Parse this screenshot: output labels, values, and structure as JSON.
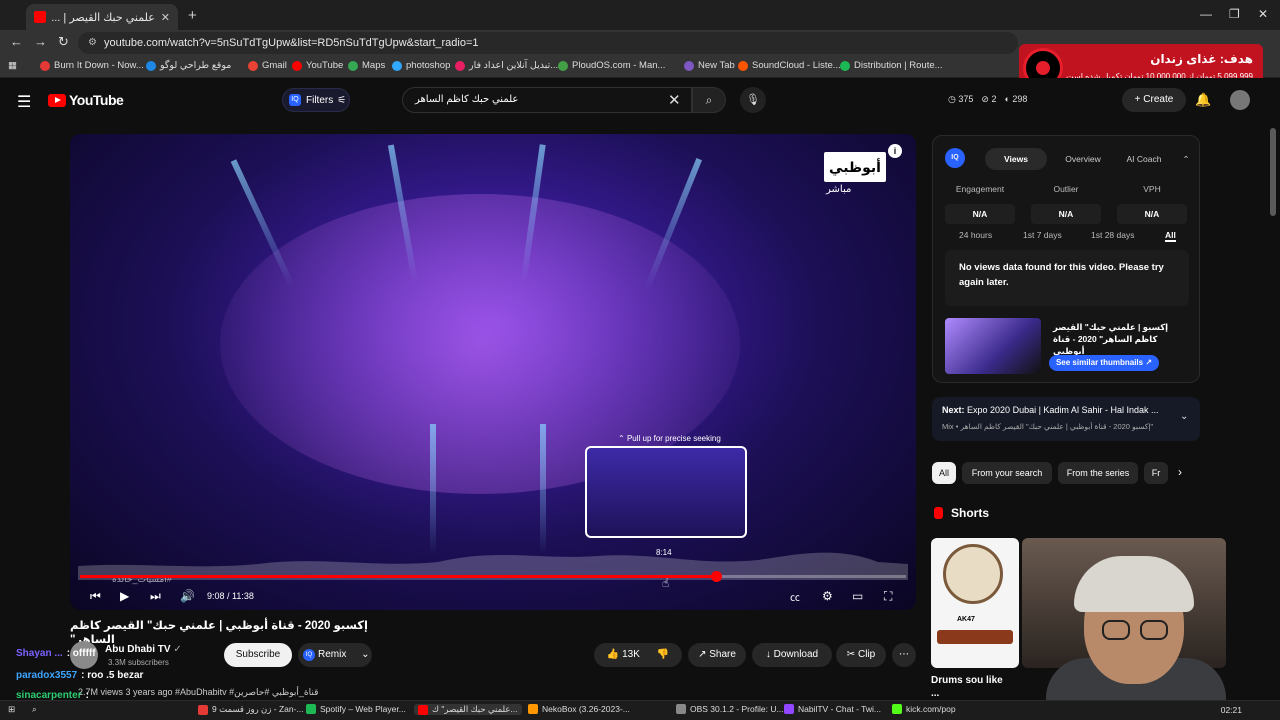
{
  "browser": {
    "tab_title": "علمني حبك القيصر | ...",
    "url": "youtube.com/watch?v=5nSuTdTgUpw&list=RD5nSuTdTgUpw&start_radio=1",
    "bookmarks": [
      {
        "label": "Burn It Down - Now...",
        "color": "#e53935"
      },
      {
        "label": "موقع طراحي لوگو",
        "color": "#1e88e5"
      },
      {
        "label": "Gmail",
        "color": "#ea4335"
      },
      {
        "label": "YouTube",
        "color": "#ff0000"
      },
      {
        "label": "Maps",
        "color": "#34a853"
      },
      {
        "label": "photoshop",
        "color": "#31a8ff"
      },
      {
        "label": "تبديل آنلاين اعداد فار...",
        "color": "#e91e63"
      },
      {
        "label": "PloudOS.com - Man...",
        "color": "#43a047"
      },
      {
        "label": "New Tab",
        "color": "#7e57c2"
      },
      {
        "label": "SoundCloud - Liste...",
        "color": "#ff5500"
      },
      {
        "label": "Distribution | Route...",
        "color": "#1db954"
      }
    ]
  },
  "ad": {
    "title": "هدف: غذای زندان",
    "subtitle": "5,099,999 تومان از 10,000,000 تومان تکمیل شده است."
  },
  "youtube": {
    "brand": "YouTube",
    "filters_label": "Filters",
    "search_value": "علمني حبك كاظم الساهر",
    "stats": [
      "375",
      "2",
      "298"
    ],
    "create_label": "Create"
  },
  "video": {
    "channel_bug": "أبوظبي",
    "channel_bug_sub": "مباشر",
    "pullup": "Pull up for precise seeking",
    "preview_time": "8:14",
    "timecode": "9:08 / 11:38",
    "watermark": "#امسيات_خالدة",
    "played_fraction": 0.77,
    "hover_fraction": 0.71,
    "title": "إكسبو 2020 - قناة أبوظبي | علمني حبك\" القيصر كاظم الساهر\"",
    "channel_name": "Abu Dhabi TV",
    "channel_subs": "3.3M subscribers",
    "subscribe_label": "Subscribe",
    "remix_label": "Remix",
    "likes": "13K",
    "share_label": "Share",
    "download_label": "Download",
    "clip_label": "Clip",
    "views_line": "2.7M views  3 years ago  #AbuDhabitv #قناة_أبوظبي #حاصرين"
  },
  "chat": [
    {
      "user": "Shayan ...",
      "msg": ": offfff",
      "color": "#7b61ff",
      "y": 0
    },
    {
      "user": "paradox3557",
      "msg": ": roo .5 bezar",
      "color": "#3ea6ff",
      "y": 22
    },
    {
      "user": "sinacarpenter",
      "msg": ": ",
      "color": "#2ecc71",
      "y": 42
    }
  ],
  "iq": {
    "tabs": [
      "Views",
      "Overview",
      "AI Coach"
    ],
    "metrics": [
      {
        "label": "Engagement",
        "value": "N/A"
      },
      {
        "label": "Outlier",
        "value": "N/A"
      },
      {
        "label": "VPH",
        "value": "N/A"
      }
    ],
    "ranges": [
      "24 hours",
      "1st 7 days",
      "1st 28 days",
      "All"
    ],
    "nodata": "No views data found for this video. Please try again later.",
    "thumb_title": "إكسبو | علمني حبك\" القيصر كاظم الساهر\" 2020 - قناة أبوظبي",
    "similar_label": "See similar thumbnails ↗"
  },
  "next": {
    "label_bold": "Next:",
    "label": "Expo 2020 Dubai | Kadim Al Sahir - Hal Indak ...",
    "sub": "Mix • إكسبو 2020 - قناة أبوظبي | علمني حبك\" القيصر كاظم الساهر\""
  },
  "chips": [
    "All",
    "From your search",
    "From the series",
    "Fr"
  ],
  "shorts": {
    "heading": "Shorts",
    "short1_label": "AK47",
    "short1_title": "Drums sou like ..."
  },
  "taskbar": {
    "items": [
      {
        "label": "9 زن روز قسمت - Zan-...",
        "color": "#e53935"
      },
      {
        "label": "Spotify – Web Player...",
        "color": "#1db954"
      },
      {
        "label": "علمني حبك القيصر\" ك...",
        "color": "#ff0000"
      },
      {
        "label": "NekoBox (3.26-2023-...",
        "color": "#ff9800"
      },
      {
        "label": "OBS 30.1.2 - Profile: U...",
        "color": "#888888"
      },
      {
        "label": "NabilTV - Chat - Twi...",
        "color": "#9146ff"
      },
      {
        "label": "kick.com/pop",
        "color": "#53fc18"
      }
    ],
    "clock": "02:21"
  }
}
